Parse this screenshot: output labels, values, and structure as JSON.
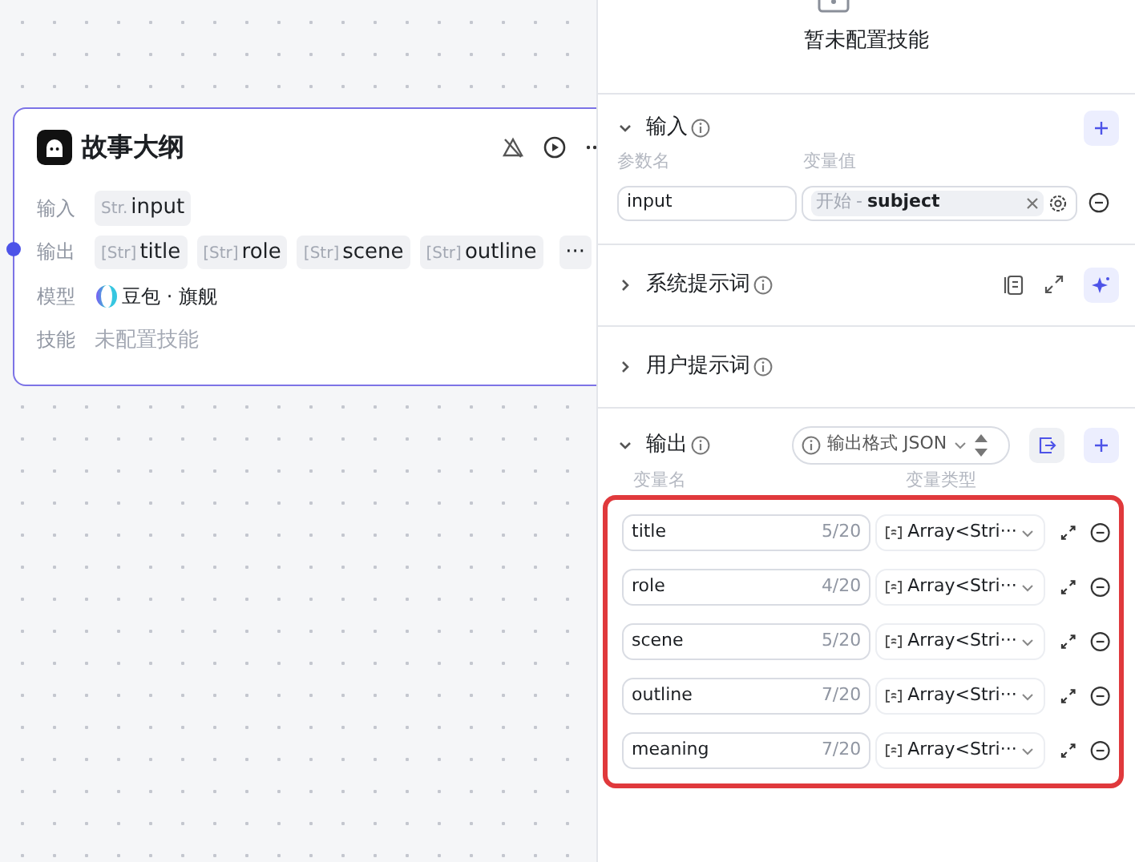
{
  "node": {
    "title": "故事大纲",
    "rows": [
      {
        "label": "输入",
        "kind": "params",
        "items": [
          {
            "type": "Str.",
            "name": "input"
          }
        ]
      },
      {
        "label": "输出",
        "kind": "params",
        "items": [
          {
            "type": "[Str]",
            "name": "title"
          },
          {
            "type": "[Str]",
            "name": "role"
          },
          {
            "type": "[Str]",
            "name": "scene"
          },
          {
            "type": "[Str]",
            "name": "outline"
          }
        ],
        "more": "···"
      },
      {
        "label": "模型",
        "kind": "model",
        "value": "豆包 · 旗舰"
      },
      {
        "label": "技能",
        "kind": "muted",
        "value": "未配置技能"
      }
    ]
  },
  "panel": {
    "skills_empty": "暂未配置技能",
    "sections": [
      {
        "kind": "input",
        "title": "输入",
        "expanded": true,
        "columns": [
          "参数名",
          "变量值"
        ],
        "rows": [
          {
            "name": "input",
            "source": "开始",
            "separator": "-",
            "variable": "subject"
          }
        ]
      },
      {
        "kind": "prompt",
        "title": "系统提示词",
        "expanded": false
      },
      {
        "kind": "prompt",
        "title": "用户提示词",
        "expanded": false
      },
      {
        "kind": "output",
        "title": "输出",
        "expanded": true,
        "format": "输出格式 JSON",
        "columns": [
          "变量名",
          "变量类型"
        ],
        "rows": [
          {
            "name": "title",
            "count": "5/20",
            "type": "Array<Stri···"
          },
          {
            "name": "role",
            "count": "4/20",
            "type": "Array<Stri···"
          },
          {
            "name": "scene",
            "count": "5/20",
            "type": "Array<Stri···"
          },
          {
            "name": "outline",
            "count": "7/20",
            "type": "Array<Stri···"
          },
          {
            "name": "meaning",
            "count": "7/20",
            "type": "Array<Stri···"
          }
        ]
      }
    ]
  }
}
